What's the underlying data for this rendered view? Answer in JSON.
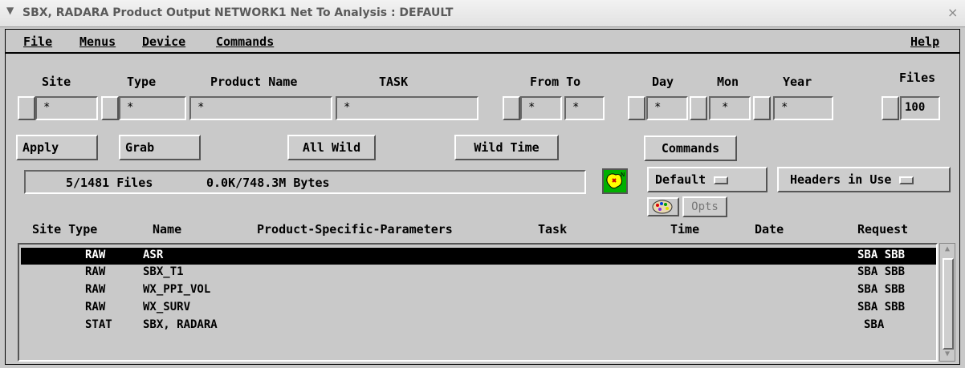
{
  "window": {
    "title": "SBX, RADARA  Product Output NETWORK1 Net To Analysis : DEFAULT",
    "close": "×"
  },
  "menubar": {
    "items": [
      "File",
      "Menus",
      "Device",
      "Commands"
    ],
    "help": "Help"
  },
  "filters": {
    "labels": {
      "site": "Site",
      "type": "Type",
      "product_name": "Product Name",
      "task": "TASK",
      "from_to": "From To",
      "day": "Day",
      "mon": "Mon",
      "year": "Year",
      "files": "Files"
    },
    "values": {
      "site": "*",
      "type": "*",
      "product_name": "*",
      "task": "*",
      "from": "*",
      "to": "*",
      "day": "*",
      "mon": "*",
      "year": "*",
      "files": "100"
    }
  },
  "buttons": {
    "apply": "Apply",
    "grab": "Grab",
    "all_wild": "All Wild",
    "wild_time": "Wild Time",
    "commands": "Commands",
    "opts": "Opts"
  },
  "options": {
    "default": "Default",
    "headers": "Headers in Use"
  },
  "status": {
    "files": "5/1481 Files",
    "bytes": "0.0K/748.3M Bytes"
  },
  "columns": {
    "site_type": "Site Type",
    "name": "Name",
    "params": "Product-Specific-Parameters",
    "task": "Task",
    "time": "Time",
    "date": "Date",
    "request": "Request"
  },
  "rows": [
    {
      "type": "RAW",
      "name": "ASR",
      "request": "SBA SBB",
      "selected": true
    },
    {
      "type": "RAW",
      "name": "SBX_T1",
      "request": "SBA SBB",
      "selected": false
    },
    {
      "type": "RAW",
      "name": "WX_PPI_VOL",
      "request": "SBA SBB",
      "selected": false
    },
    {
      "type": "RAW",
      "name": "WX_SURV",
      "request": "SBA SBB",
      "selected": false
    },
    {
      "type": "STAT",
      "name": "SBX, RADARA",
      "request": "SBA",
      "selected": false
    }
  ],
  "colors": {
    "background": "#c9c9c9",
    "selected_row": "#000000",
    "map_icon_bg": "#00c000",
    "map_blob": "#ffff00"
  }
}
